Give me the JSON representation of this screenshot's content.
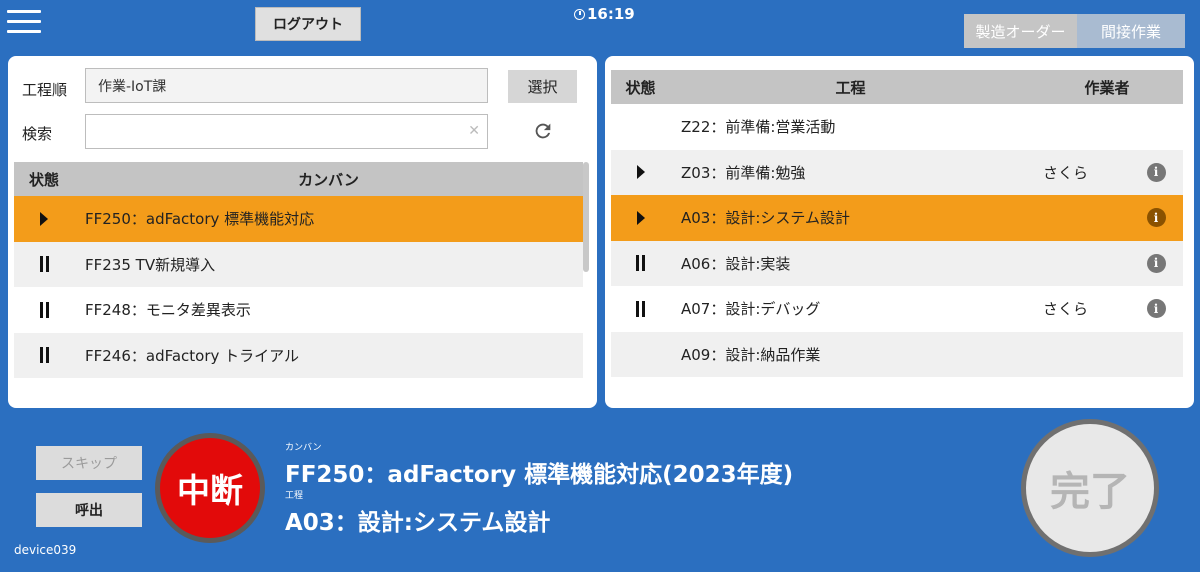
{
  "header": {
    "logout_label": "ログアウト",
    "time": "16:19",
    "mode_tabs": [
      "製造オーダー",
      "間接作業"
    ]
  },
  "left_panel": {
    "order_label": "工程順",
    "order_value": "作業-IoT課",
    "select_label": "選択",
    "search_label": "検索",
    "search_value": "",
    "columns": [
      "状態",
      "カンバン"
    ],
    "rows": [
      {
        "state": "play",
        "text": "FF250：adFactory 標準機能対応"
      },
      {
        "state": "pause",
        "text": "FF235 TV新規導入"
      },
      {
        "state": "pause",
        "text": "FF248：モニタ差異表示"
      },
      {
        "state": "pause",
        "text": "FF246：adFactory トライアル"
      }
    ]
  },
  "right_panel": {
    "columns": [
      "状態",
      "工程",
      "作業者"
    ],
    "rows": [
      {
        "state": "",
        "text": "Z22：前準備:営業活動",
        "worker": "",
        "info": false
      },
      {
        "state": "play",
        "text": "Z03：前準備:勉強",
        "worker": "さくら",
        "info": true
      },
      {
        "state": "play",
        "text": "A03：設計:システム設計",
        "worker": "",
        "info": true
      },
      {
        "state": "pause",
        "text": "A06：設計:実装",
        "worker": "",
        "info": true
      },
      {
        "state": "pause",
        "text": "A07：設計:デバッグ",
        "worker": "さくら",
        "info": true
      },
      {
        "state": "",
        "text": "A09：設計:納品作業",
        "worker": "",
        "info": false
      }
    ]
  },
  "bottom": {
    "skip_label": "スキップ",
    "call_label": "呼出",
    "device": "device039",
    "suspend_label": "中断",
    "kanban_small": "カンバン",
    "kanban_value": "FF250：adFactory 標準機能対応(2023年度)",
    "process_small": "工程",
    "process_value": "A03：設計:システム設計",
    "complete_label": "完了"
  },
  "colors": {
    "background": "#2b6fc0",
    "selected_row": "#f39c1a",
    "suspend": "#e20a0a"
  }
}
